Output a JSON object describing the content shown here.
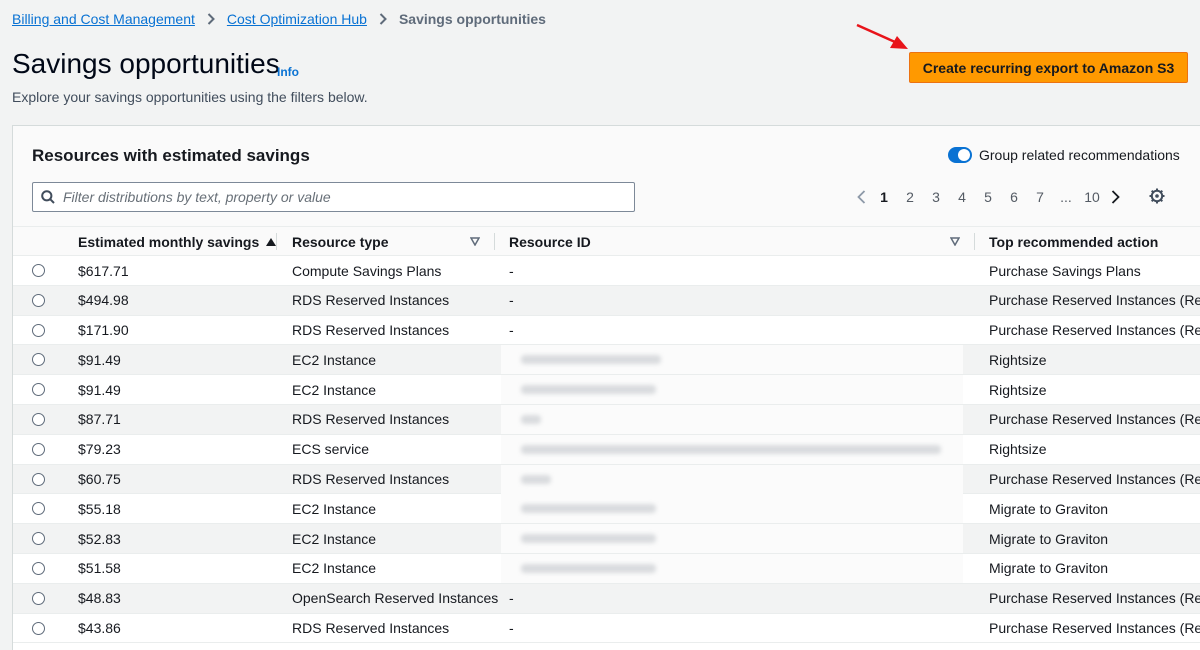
{
  "breadcrumb": {
    "items": [
      "Billing and Cost Management",
      "Cost Optimization Hub"
    ],
    "current": "Savings opportunities"
  },
  "header": {
    "title": "Savings opportunities",
    "info": "Info",
    "description": "Explore your savings opportunities using the filters below.",
    "export_button": "Create recurring export to Amazon S3"
  },
  "panel": {
    "title": "Resources with estimated savings",
    "toggle_label": "Group related recommendations",
    "toggle_on": true,
    "search_placeholder": "Filter distributions by text, property or value"
  },
  "pagination": {
    "pages": [
      "1",
      "2",
      "3",
      "4",
      "5",
      "6",
      "7",
      "...",
      "10"
    ],
    "current": "1"
  },
  "table": {
    "columns": [
      "Estimated monthly savings",
      "Resource type",
      "Resource ID",
      "Top recommended action"
    ],
    "rows": [
      {
        "savings": "$617.71",
        "type": "Compute Savings Plans",
        "id": "-",
        "action": "Purchase Savings Plans",
        "redacted": false
      },
      {
        "savings": "$494.98",
        "type": "RDS Reserved Instances",
        "id": "-",
        "action": "Purchase Reserved Instances (Rese",
        "redacted": false
      },
      {
        "savings": "$171.90",
        "type": "RDS Reserved Instances",
        "id": "-",
        "action": "Purchase Reserved Instances (Rese",
        "redacted": false
      },
      {
        "savings": "$91.49",
        "type": "EC2 Instance",
        "id": "",
        "action": "Rightsize",
        "redacted": true
      },
      {
        "savings": "$91.49",
        "type": "EC2 Instance",
        "id": "",
        "action": "Rightsize",
        "redacted": true
      },
      {
        "savings": "$87.71",
        "type": "RDS Reserved Instances",
        "id": "",
        "action": "Purchase Reserved Instances (Rese",
        "redacted": true
      },
      {
        "savings": "$79.23",
        "type": "ECS service",
        "id": "",
        "action": "Rightsize",
        "redacted": true
      },
      {
        "savings": "$60.75",
        "type": "RDS Reserved Instances",
        "id": "",
        "action": "Purchase Reserved Instances (Rese",
        "redacted": true
      },
      {
        "savings": "$55.18",
        "type": "EC2 Instance",
        "id": "",
        "action": "Migrate to Graviton",
        "redacted": true
      },
      {
        "savings": "$52.83",
        "type": "EC2 Instance",
        "id": "",
        "action": "Migrate to Graviton",
        "redacted": true
      },
      {
        "savings": "$51.58",
        "type": "EC2 Instance",
        "id": "",
        "action": "Migrate to Graviton",
        "redacted": true
      },
      {
        "savings": "$48.83",
        "type": "OpenSearch Reserved Instances",
        "id": "-",
        "action": "Purchase Reserved Instances (Rese",
        "redacted": false
      },
      {
        "savings": "$43.86",
        "type": "RDS Reserved Instances",
        "id": "-",
        "action": "Purchase Reserved Instances (Rese",
        "redacted": false
      }
    ]
  },
  "colors": {
    "primary_button": "#ff9900",
    "link": "#0972d3",
    "toggle": "#0972d3",
    "annotation_arrow": "#e8141a"
  },
  "icons": [
    "chevron-right-icon",
    "search-icon",
    "sort-ascending-icon",
    "filter-caret-icon",
    "chevron-left-icon",
    "settings-gear-icon",
    "red-arrow-icon"
  ]
}
